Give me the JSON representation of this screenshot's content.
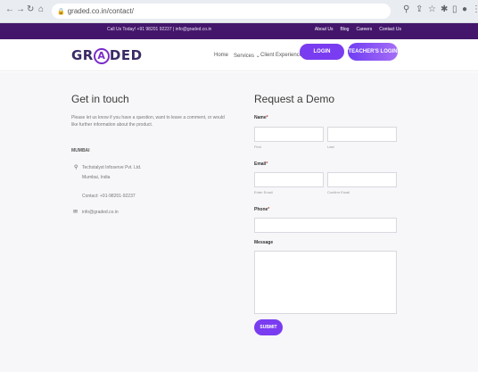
{
  "browser": {
    "url": "graded.co.in/contact/"
  },
  "topbar": {
    "contact": "Call Us Today! +91 98201 92237 | info@graded.co.in",
    "links": [
      "About Us",
      "Blog",
      "Careers",
      "Contact Us"
    ]
  },
  "header": {
    "logo_left": "GR",
    "logo_mid": "A",
    "logo_right": "DED",
    "menu": [
      "Home",
      "Services",
      "Client Experience"
    ],
    "login": "LOGIN",
    "teacher_login": "TEACHER'S LOGIN"
  },
  "contact": {
    "title": "Get in touch",
    "intro": "Please let us know if you have a question, want to leave a comment, or would like further information about the product.",
    "office_label": "MUMBAI",
    "company": "Techstalyst Infoserve Pvt. Ltd.",
    "city": "Mumbai, India",
    "phone": "Contact: +91-98201-92237",
    "email": "info@graded.co.in"
  },
  "form": {
    "title": "Request a Demo",
    "name_label": "Name",
    "first_hint": "First",
    "last_hint": "Last",
    "email_label": "Email",
    "enter_email_hint": "Enter Email",
    "confirm_email_hint": "Confirm Email",
    "phone_label": "Phone",
    "message_label": "Message",
    "required_mark": "*",
    "submit": "SUBMIT"
  }
}
